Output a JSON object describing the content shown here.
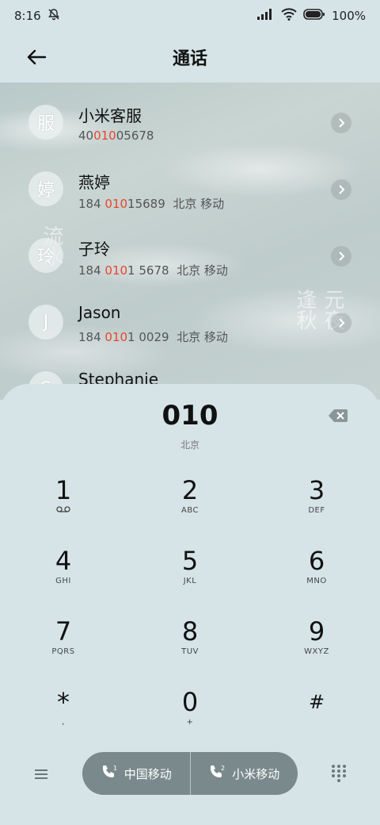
{
  "status_bar": {
    "time": "8:16",
    "battery": "100%",
    "icons": [
      "bell-muted-icon",
      "signal-icon",
      "wifi-icon",
      "battery-icon"
    ]
  },
  "app_bar": {
    "title": "通话"
  },
  "contacts": [
    {
      "avatar": "服",
      "name": "小米客服",
      "num_pre": "40",
      "num_hl": "010",
      "num_post": "05678",
      "location": ""
    },
    {
      "avatar": "婷",
      "name": "燕婷",
      "num_pre": "184 ",
      "num_hl": "010",
      "num_post": "15689",
      "location": "北京 移动"
    },
    {
      "avatar": "玲",
      "name": "子玲",
      "num_pre": "184 ",
      "num_hl": "010",
      "num_post": "1 5678",
      "location": "北京 移动"
    },
    {
      "avatar": "J",
      "name": "Jason",
      "num_pre": "184 ",
      "num_hl": "010",
      "num_post": "1 0029",
      "location": "北京 移动"
    },
    {
      "avatar": "S",
      "name": "Stephanie",
      "num_pre": "",
      "num_hl": "",
      "num_post": "",
      "location": ""
    }
  ],
  "dialpad": {
    "typed": "010",
    "region": "北京",
    "keys": [
      {
        "d": "1",
        "s": "∞"
      },
      {
        "d": "2",
        "s": "ABC"
      },
      {
        "d": "3",
        "s": "DEF"
      },
      {
        "d": "4",
        "s": "GHI"
      },
      {
        "d": "5",
        "s": "JKL"
      },
      {
        "d": "6",
        "s": "MNO"
      },
      {
        "d": "7",
        "s": "PQRS"
      },
      {
        "d": "8",
        "s": "TUV"
      },
      {
        "d": "9",
        "s": "WXYZ"
      },
      {
        "d": "*",
        "s": ","
      },
      {
        "d": "0",
        "s": "+"
      },
      {
        "d": "#",
        "s": ""
      }
    ]
  },
  "bottom_bar": {
    "sim1_label": "中国移动",
    "sim2_label": "小米移动"
  },
  "colors": {
    "highlight": "#e8452c",
    "sim_button": "#7a8a8c",
    "panel_bg": "#d6e4e8"
  }
}
